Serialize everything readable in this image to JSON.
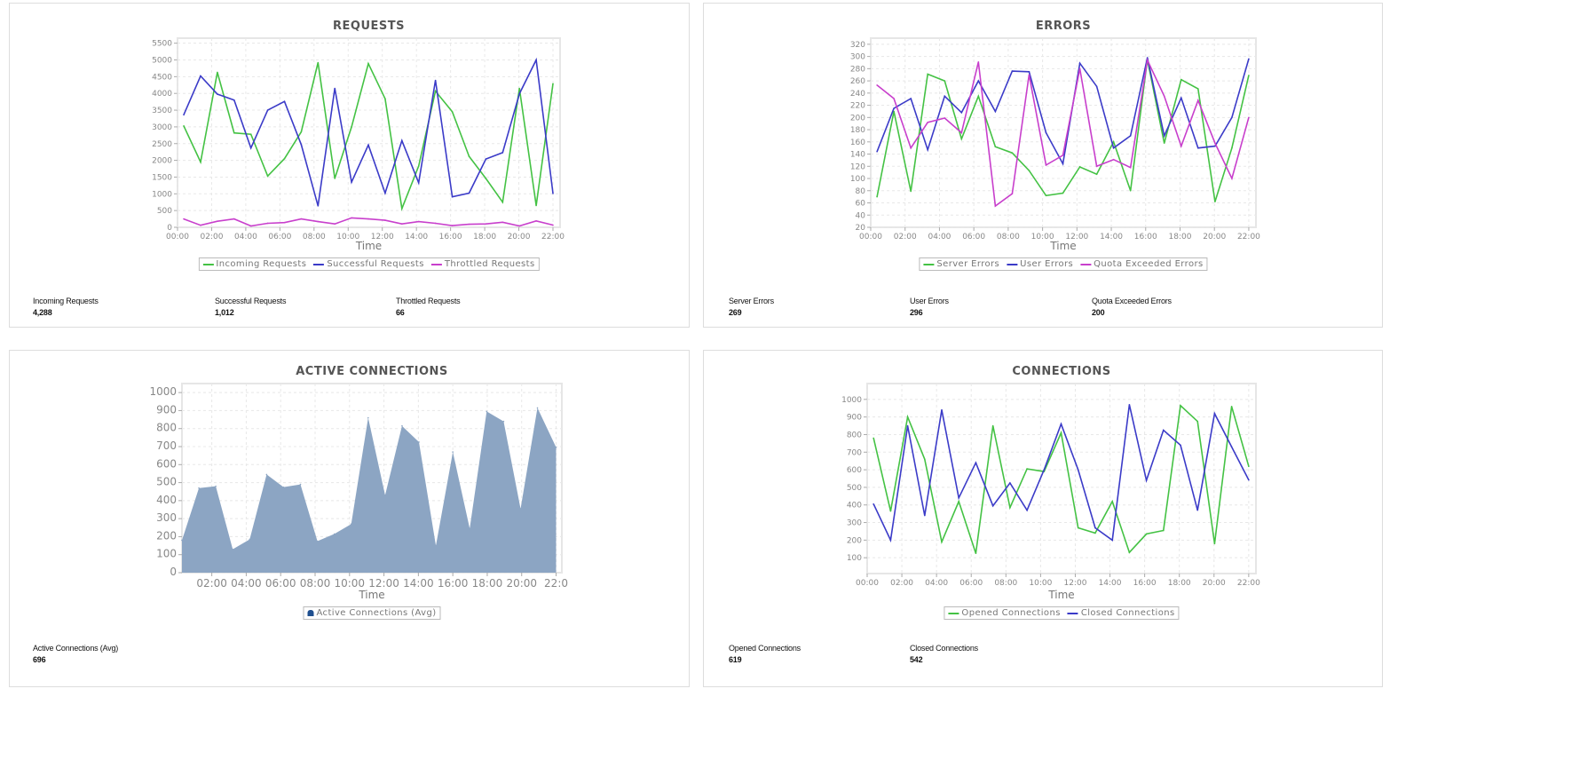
{
  "colors": {
    "green": "#44c244",
    "blue": "#3b3bc8",
    "magenta": "#c83fcc",
    "area": "#8ca5c3",
    "area_legend": "#1f4f8f"
  },
  "chart_data": [
    {
      "type": "line",
      "title": "REQUESTS",
      "xlabel": "Time",
      "ylabel": "",
      "x": [
        "00:22",
        "01:21",
        "02:20",
        "03:19",
        "04:18",
        "05:17",
        "06:16",
        "07:15",
        "08:14",
        "09:13",
        "10:12",
        "11:11",
        "12:10",
        "13:09",
        "14:08",
        "15:07",
        "16:06",
        "17:05",
        "18:04",
        "19:03",
        "20:02",
        "21:01",
        "22:00"
      ],
      "xlim": [
        "00:00",
        "22:25"
      ],
      "ylim": [
        0,
        5650
      ],
      "grid": true,
      "legend": "bottom",
      "yticks": [
        "0",
        "500",
        "1000",
        "1500",
        "2000",
        "2500",
        "3000",
        "3500",
        "4000",
        "4500",
        "5000",
        "5500"
      ],
      "xticks": [
        "00:00",
        "02:00",
        "04:00",
        "06:00",
        "08:00",
        "10:00",
        "12:00",
        "14:00",
        "16:00",
        "18:00",
        "20:00",
        "22:00"
      ],
      "series": [
        {
          "name": "Incoming Requests",
          "color": "#44c244",
          "values": [
            3030,
            1950,
            4630,
            2820,
            2780,
            1530,
            2050,
            2850,
            4920,
            1460,
            3000,
            4890,
            3840,
            560,
            1830,
            4070,
            3450,
            2120,
            1460,
            750,
            4150,
            650,
            4288
          ]
        },
        {
          "name": "Successful Requests",
          "color": "#3b3bc8",
          "values": [
            3360,
            4520,
            3980,
            3800,
            2370,
            3500,
            3760,
            2470,
            640,
            4150,
            1350,
            2460,
            1020,
            2590,
            1330,
            4390,
            910,
            1020,
            2040,
            2230,
            3990,
            5000,
            1012
          ]
        },
        {
          "name": "Throttled Requests",
          "color": "#c83fcc",
          "values": [
            250,
            60,
            180,
            250,
            40,
            120,
            140,
            250,
            170,
            100,
            280,
            250,
            210,
            100,
            170,
            120,
            50,
            90,
            100,
            150,
            40,
            190,
            66
          ]
        }
      ],
      "stats": [
        {
          "label": "Incoming Requests",
          "value": "4,288"
        },
        {
          "label": "Successful Requests",
          "value": "1,012"
        },
        {
          "label": "Throttled Requests",
          "value": "66"
        }
      ]
    },
    {
      "type": "line",
      "title": "ERRORS",
      "xlabel": "Time",
      "ylabel": "",
      "x": [
        "00:22",
        "01:21",
        "02:20",
        "03:19",
        "04:18",
        "05:17",
        "06:16",
        "07:15",
        "08:14",
        "09:13",
        "10:12",
        "11:11",
        "12:10",
        "13:09",
        "14:08",
        "15:07",
        "16:06",
        "17:05",
        "18:04",
        "19:03",
        "20:02",
        "21:01",
        "22:00"
      ],
      "xlim": [
        "00:00",
        "22:25"
      ],
      "ylim": [
        20,
        330
      ],
      "grid": true,
      "legend": "bottom",
      "yticks": [
        "20",
        "40",
        "60",
        "80",
        "100",
        "120",
        "140",
        "160",
        "180",
        "200",
        "220",
        "240",
        "260",
        "280",
        "300",
        "320"
      ],
      "xticks": [
        "00:00",
        "02:00",
        "04:00",
        "06:00",
        "08:00",
        "10:00",
        "12:00",
        "14:00",
        "16:00",
        "18:00",
        "20:00",
        "22:00"
      ],
      "series": [
        {
          "name": "Server Errors",
          "color": "#44c244",
          "values": [
            70,
            210,
            79,
            271,
            260,
            165,
            235,
            152,
            142,
            113,
            72,
            76,
            119,
            107,
            160,
            80,
            295,
            158,
            262,
            247,
            62,
            150,
            269
          ]
        },
        {
          "name": "User Errors",
          "color": "#3b3bc8",
          "values": [
            144,
            215,
            231,
            147,
            235,
            208,
            260,
            210,
            276,
            275,
            175,
            124,
            289,
            251,
            150,
            170,
            298,
            170,
            232,
            150,
            153,
            200,
            296
          ]
        },
        {
          "name": "Quota Exceeded Errors",
          "color": "#c83fcc",
          "values": [
            253,
            231,
            150,
            192,
            199,
            175,
            291,
            55,
            75,
            270,
            122,
            138,
            280,
            120,
            131,
            118,
            294,
            235,
            153,
            228,
            158,
            100,
            200
          ]
        }
      ],
      "stats": [
        {
          "label": "Server Errors",
          "value": "269"
        },
        {
          "label": "User Errors",
          "value": "296"
        },
        {
          "label": "Quota Exceeded Errors",
          "value": "200"
        }
      ]
    },
    {
      "type": "area",
      "title": "ACTIVE CONNECTIONS",
      "xlabel": "Time",
      "ylabel": "",
      "x": [
        "00:16",
        "01:15",
        "02:14",
        "03:13",
        "04:12",
        "05:11",
        "06:10",
        "07:09",
        "08:08",
        "09:07",
        "10:06",
        "11:05",
        "12:04",
        "13:03",
        "14:02",
        "15:01",
        "16:00",
        "16:59",
        "17:58",
        "18:57",
        "19:56",
        "20:55",
        "22:00"
      ],
      "xlim": [
        "00:16",
        "22:20"
      ],
      "ylim": [
        0,
        1050
      ],
      "grid": true,
      "legend": "bottom",
      "yticks": [
        "0",
        "100",
        "200",
        "300",
        "400",
        "500",
        "600",
        "700",
        "800",
        "900",
        "1000"
      ],
      "xticks": [
        "02:00",
        "04:00",
        "06:00",
        "08:00",
        "10:00",
        "12:00",
        "14:00",
        "16:00",
        "18:00",
        "20:00",
        "22:0"
      ],
      "series": [
        {
          "name": "Active Connections (Avg)",
          "color": "#8ca5c3",
          "values": [
            180,
            470,
            480,
            130,
            185,
            545,
            475,
            490,
            175,
            215,
            270,
            860,
            430,
            815,
            725,
            150,
            670,
            245,
            895,
            840,
            355,
            915,
            696
          ]
        }
      ],
      "stats": [
        {
          "label": "Active Connections (Avg)",
          "value": "696"
        }
      ]
    },
    {
      "type": "line",
      "title": "CONNECTIONS",
      "xlabel": "Time",
      "ylabel": "",
      "x": [
        "00:22",
        "01:21",
        "02:20",
        "03:19",
        "04:18",
        "05:17",
        "06:16",
        "07:15",
        "08:14",
        "09:13",
        "10:12",
        "11:11",
        "12:10",
        "13:09",
        "14:08",
        "15:07",
        "16:06",
        "17:05",
        "18:04",
        "19:03",
        "20:02",
        "21:01",
        "22:00"
      ],
      "xlim": [
        "00:00",
        "22:25"
      ],
      "ylim": [
        10,
        1090
      ],
      "grid": true,
      "legend": "bottom",
      "yticks": [
        "100",
        "200",
        "300",
        "400",
        "500",
        "600",
        "700",
        "800",
        "900",
        "1000"
      ],
      "xticks": [
        "00:00",
        "02:00",
        "04:00",
        "06:00",
        "08:00",
        "10:00",
        "12:00",
        "14:00",
        "16:00",
        "18:00",
        "20:00",
        "22:00"
      ],
      "series": [
        {
          "name": "Opened Connections",
          "color": "#44c244",
          "values": [
            780,
            365,
            900,
            660,
            190,
            420,
            125,
            850,
            385,
            605,
            590,
            810,
            270,
            240,
            420,
            130,
            235,
            255,
            965,
            875,
            180,
            960,
            619
          ]
        },
        {
          "name": "Closed Connections",
          "color": "#3b3bc8",
          "values": [
            405,
            200,
            850,
            340,
            940,
            440,
            640,
            395,
            525,
            370,
            600,
            860,
            600,
            270,
            200,
            970,
            540,
            825,
            740,
            370,
            920,
            730,
            542
          ]
        }
      ],
      "stats": [
        {
          "label": "Opened Connections",
          "value": "619"
        },
        {
          "label": "Closed Connections",
          "value": "542"
        }
      ]
    }
  ]
}
